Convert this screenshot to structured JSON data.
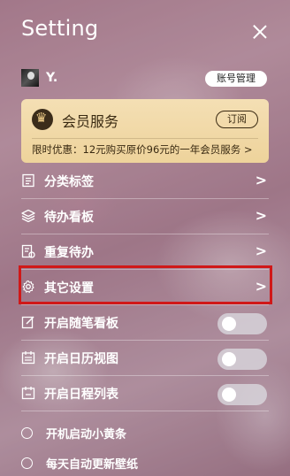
{
  "window": {
    "title": "Setting"
  },
  "user": {
    "name": "Y.",
    "account_button": "账号管理"
  },
  "vip": {
    "title": "会员服务",
    "subscribe_label": "订阅",
    "offer_text": "限时优惠：12元购买原价96元的一年会员服务 >"
  },
  "menu": [
    {
      "label": "分类标签",
      "icon": "list-icon"
    },
    {
      "label": "待办看板",
      "icon": "layers-icon"
    },
    {
      "label": "重复待办",
      "icon": "repeat-todo-icon"
    },
    {
      "label": "其它设置",
      "icon": "gear-icon"
    }
  ],
  "toggles": [
    {
      "label": "开启随笔看板",
      "icon": "note-edit-icon",
      "on": false
    },
    {
      "label": "开启日历视图",
      "icon": "calendar-icon",
      "on": false
    },
    {
      "label": "开启日程列表",
      "icon": "schedule-icon",
      "on": false
    }
  ],
  "options": [
    {
      "label": "开机启动小黄条",
      "checked": false
    },
    {
      "label": "每天自动更新壁纸",
      "checked": false
    }
  ],
  "arrow_glyph": ">",
  "colors": {
    "accent_gold": "#eed39b",
    "highlight_red": "#d01818"
  }
}
